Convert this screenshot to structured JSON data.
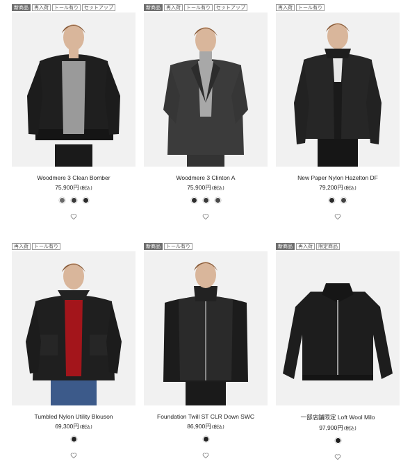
{
  "products": [
    {
      "badges": [
        "新商品",
        "再入荷",
        "トール有り",
        "セットアップ"
      ],
      "name": "Woodmere 3 Clean Bomber",
      "price": "75,900円",
      "tax": "(税込)",
      "swatches": [
        "#6b6b6b",
        "#3a3a3a",
        "#2b2b2b"
      ],
      "image": "model-black-bomber-grey-knit"
    },
    {
      "badges": [
        "新商品",
        "再入荷",
        "トール有り",
        "セットアップ"
      ],
      "name": "Woodmere 3 Clinton A",
      "price": "75,900円",
      "tax": "(税込)",
      "swatches": [
        "#2e2e2e",
        "#3a3a3a",
        "#4a4a4a"
      ],
      "image": "model-charcoal-blazer-grey-turtleneck"
    },
    {
      "badges": [
        "再入荷",
        "トール有り"
      ],
      "name": "New Paper Nylon Hazelton DF",
      "price": "79,200円",
      "tax": "(税込)",
      "swatches": [
        "#2a2a2a",
        "#444444"
      ],
      "image": "model-black-quilted-jacket"
    },
    {
      "badges": [
        "再入荷",
        "トール有り"
      ],
      "name": "Tumbled Nylon Utility Blouson",
      "price": "69,300円",
      "tax": "(税込)",
      "swatches": [
        "#222222"
      ],
      "image": "model-black-blouson-red-knit"
    },
    {
      "badges": [
        "新商品",
        "トール有り"
      ],
      "name": "Foundation Twill ST CLR Down SWC",
      "price": "86,900円",
      "tax": "(税込)",
      "swatches": [
        "#222222"
      ],
      "image": "model-black-down-vest"
    },
    {
      "badges": [
        "新商品",
        "再入荷",
        "限定商品"
      ],
      "name": "一部店舗限定 Loft Wool Milo",
      "price": "97,900円",
      "tax": "(税込)",
      "swatches": [
        "#1e1e1e"
      ],
      "image": "black-wool-jacket-flat"
    }
  ],
  "colors": {
    "badge_new_bg": "#6e6e6e",
    "image_bg": "#f1f1f1"
  },
  "icons": {
    "favorite": "heart-outline-icon"
  }
}
